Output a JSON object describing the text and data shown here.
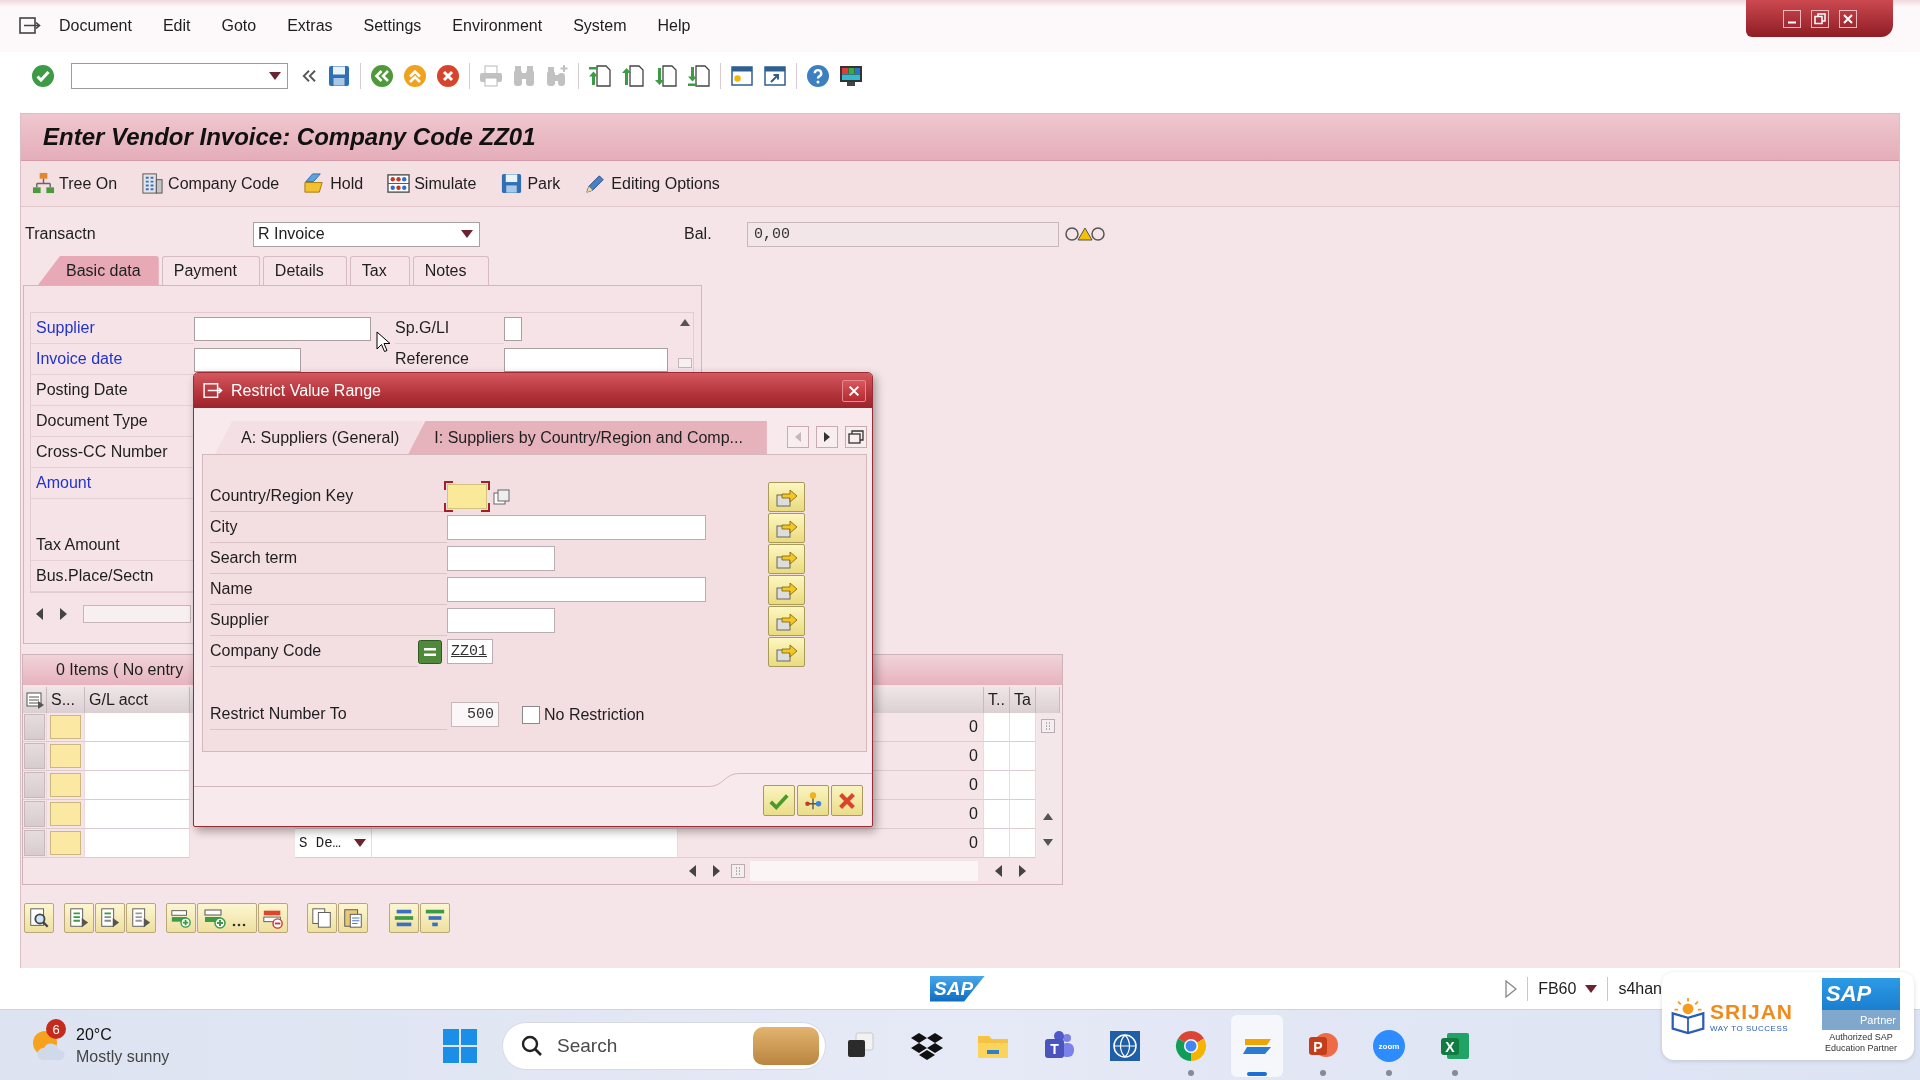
{
  "menu_bar": {
    "items": [
      "Document",
      "Edit",
      "Goto",
      "Extras",
      "Settings",
      "Environment",
      "System",
      "Help"
    ]
  },
  "toolbar": {
    "buttons": [
      {
        "disabled": false
      },
      {
        "disabled": false
      },
      {
        "disabled": false
      },
      {
        "disabled": false
      },
      {
        "disabled": false
      },
      {
        "disabled": false
      },
      {
        "disabled": true
      },
      {
        "disabled": true
      },
      {
        "disabled": true
      },
      {
        "disabled": false
      },
      {
        "disabled": false
      },
      {
        "disabled": false
      },
      {
        "disabled": false
      },
      {
        "disabled": false
      },
      {
        "disabled": false
      },
      {
        "disabled": false
      },
      {
        "disabled": false
      }
    ]
  },
  "title": "Enter Vendor Invoice: Company Code ZZ01",
  "application_toolbar": {
    "buttons": [
      "Tree On",
      "Company Code",
      "Hold",
      "Simulate",
      "Park",
      "Editing Options"
    ]
  },
  "header": {
    "transaction_label": "Transactn",
    "transaction_value": "R Invoice",
    "balance_label": "Bal.",
    "balance_value": "0,00"
  },
  "tabs": [
    {
      "label": "Basic data",
      "selected": true
    },
    {
      "label": "Payment",
      "selected": false
    },
    {
      "label": "Details",
      "selected": false
    },
    {
      "label": "Tax",
      "selected": false
    },
    {
      "label": "Notes",
      "selected": false
    }
  ],
  "basic_data": {
    "field_groups": [
      {
        "fields": [
          {
            "label": "Supplier",
            "required": true,
            "input": true
          },
          {
            "label": "Invoice date",
            "required": true,
            "input": true
          },
          {
            "label": "Posting Date",
            "required": false
          },
          {
            "label": "Document Type",
            "required": false
          },
          {
            "label": "Cross-CC Number",
            "required": false
          },
          {
            "label": "Amount",
            "required": true
          }
        ]
      },
      {
        "fields": [
          {
            "label": "Tax Amount",
            "required": false
          },
          {
            "label": "Bus.Place/Sectn",
            "required": false
          }
        ]
      }
    ],
    "side_fields": [
      {
        "label": "Sp.G/LI",
        "input": true
      },
      {
        "label": "Reference",
        "input": true
      }
    ]
  },
  "items_table": {
    "summary": "0 Items ( No entry",
    "columns": [
      "S...",
      "G/L acct",
      "T..",
      "Ta"
    ],
    "rows": [
      {
        "number": "0"
      },
      {
        "number": "0"
      },
      {
        "number": "0"
      },
      {
        "number": "0"
      },
      {
        "dropdown": "S De…",
        "number": "0"
      }
    ]
  },
  "dialog": {
    "title": "Restrict Value Range",
    "tabs": [
      {
        "label": "A: Suppliers (General)",
        "selected": false
      },
      {
        "label": "I: Suppliers by Country/Region and Comp...",
        "selected": true
      }
    ],
    "fields": [
      {
        "label": "Country/Region Key",
        "focused": true,
        "operator_icon": false
      },
      {
        "label": "City",
        "focused": false,
        "operator_icon": false
      },
      {
        "label": "Search term",
        "focused": false,
        "operator_icon": false
      },
      {
        "label": "Name",
        "focused": false,
        "operator_icon": false
      },
      {
        "label": "Supplier",
        "focused": false,
        "operator_icon": false
      },
      {
        "label": "Company Code",
        "value": "ZZ01",
        "focused": false,
        "operator_icon": true
      }
    ],
    "restrict": {
      "label": "Restrict Number To",
      "value": "500"
    },
    "no_restriction": {
      "label": "No Restriction",
      "checked": false
    }
  },
  "status_bar": {
    "logo": "SAP",
    "transaction": "FB60",
    "system": "s4han"
  },
  "taskbar": {
    "weather": {
      "alerts": "6",
      "temperature": "20°C",
      "condition": "Mostly sunny"
    },
    "search": {
      "placeholder": "Search"
    },
    "apps": [
      {
        "running": false,
        "active": false
      },
      {
        "running": false,
        "active": false
      },
      {
        "running": false,
        "active": false
      },
      {
        "glyph": "T",
        "running": false,
        "active": false
      },
      {
        "running": false,
        "active": false
      },
      {
        "running": true,
        "active": false
      },
      {
        "running": true,
        "active": true
      },
      {
        "glyph": "P",
        "running": true,
        "active": false
      },
      {
        "glyph": "zoom",
        "running": true,
        "active": false
      },
      {
        "glyph": "X",
        "running": true,
        "active": false
      }
    ]
  },
  "partner_badge": {
    "brand": "SRIJAN",
    "tagline": "WAY TO SUCCESS",
    "logo": "SAP",
    "logo_caption": "Partner",
    "caption": "Authorized SAP Education Partner"
  }
}
